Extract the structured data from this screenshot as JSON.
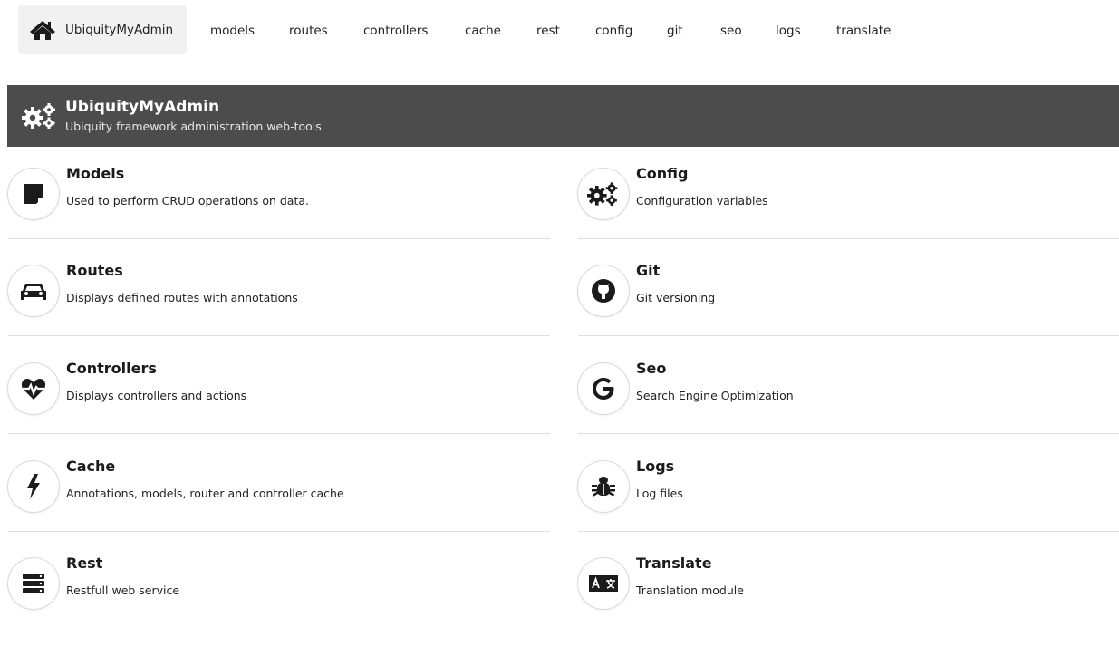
{
  "nav": {
    "home_label": "UbiquityMyAdmin",
    "items": [
      "models",
      "routes",
      "controllers",
      "cache",
      "rest",
      "config",
      "git",
      "seo",
      "logs",
      "translate"
    ]
  },
  "banner": {
    "title": "UbiquityMyAdmin",
    "subtitle": "Ubiquity framework administration web-tools"
  },
  "modules": {
    "left": [
      {
        "title": "Models",
        "desc": "Used to perform CRUD operations on data.",
        "icon": "sticky-note-icon"
      },
      {
        "title": "Routes",
        "desc": "Displays defined routes with annotations",
        "icon": "car-icon"
      },
      {
        "title": "Controllers",
        "desc": "Displays controllers and actions",
        "icon": "heartbeat-icon"
      },
      {
        "title": "Cache",
        "desc": "Annotations, models, router and controller cache",
        "icon": "lightning-icon"
      },
      {
        "title": "Rest",
        "desc": "Restfull web service",
        "icon": "server-icon"
      }
    ],
    "right": [
      {
        "title": "Config",
        "desc": "Configuration variables",
        "icon": "cogs-icon"
      },
      {
        "title": "Git",
        "desc": "Git versioning",
        "icon": "github-icon"
      },
      {
        "title": "Seo",
        "desc": "Search Engine Optimization",
        "icon": "google-icon"
      },
      {
        "title": "Logs",
        "desc": "Log files",
        "icon": "bug-icon"
      },
      {
        "title": "Translate",
        "desc": "Translation module",
        "icon": "language-icon"
      }
    ]
  },
  "colors": {
    "banner_bg": "#4c4c4c",
    "nav_active_bg": "#f1f1f1"
  }
}
